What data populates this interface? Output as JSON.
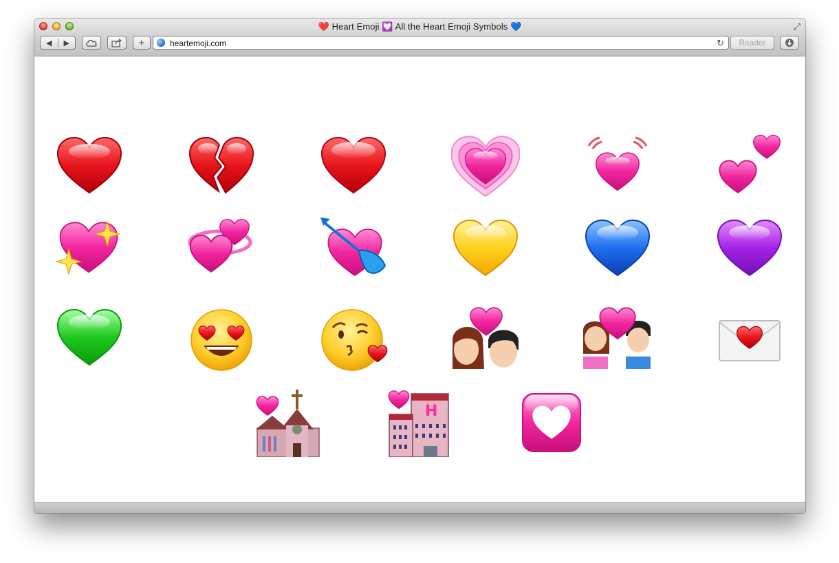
{
  "window": {
    "title": "❤️ Heart Emoji 💟 All the Heart Emoji Symbols 💙"
  },
  "toolbar": {
    "back_icon": "◀",
    "forward_icon": "▶",
    "add_icon": "+",
    "url": "heartemoji.com",
    "reader_label": "Reader"
  },
  "emojis": [
    {
      "name": "red-heart"
    },
    {
      "name": "broken-heart"
    },
    {
      "name": "red-heart-2"
    },
    {
      "name": "growing-heart"
    },
    {
      "name": "beating-heart"
    },
    {
      "name": "two-hearts"
    },
    {
      "name": "sparkling-heart"
    },
    {
      "name": "revolving-hearts"
    },
    {
      "name": "heart-with-arrow"
    },
    {
      "name": "yellow-heart"
    },
    {
      "name": "blue-heart"
    },
    {
      "name": "purple-heart"
    },
    {
      "name": "green-heart"
    },
    {
      "name": "heart-eyes-face"
    },
    {
      "name": "kissing-heart-face"
    },
    {
      "name": "kiss-couple"
    },
    {
      "name": "couple-with-heart"
    },
    {
      "name": "love-letter"
    },
    {
      "name": "wedding-chapel"
    },
    {
      "name": "love-hotel"
    },
    {
      "name": "heart-decoration"
    }
  ],
  "colors": {
    "red": "#e8141b",
    "pink": "#f2259e",
    "yellow": "#ffd21f",
    "blue": "#1f6ff0",
    "purple": "#a522e6",
    "green": "#1ec81e"
  }
}
